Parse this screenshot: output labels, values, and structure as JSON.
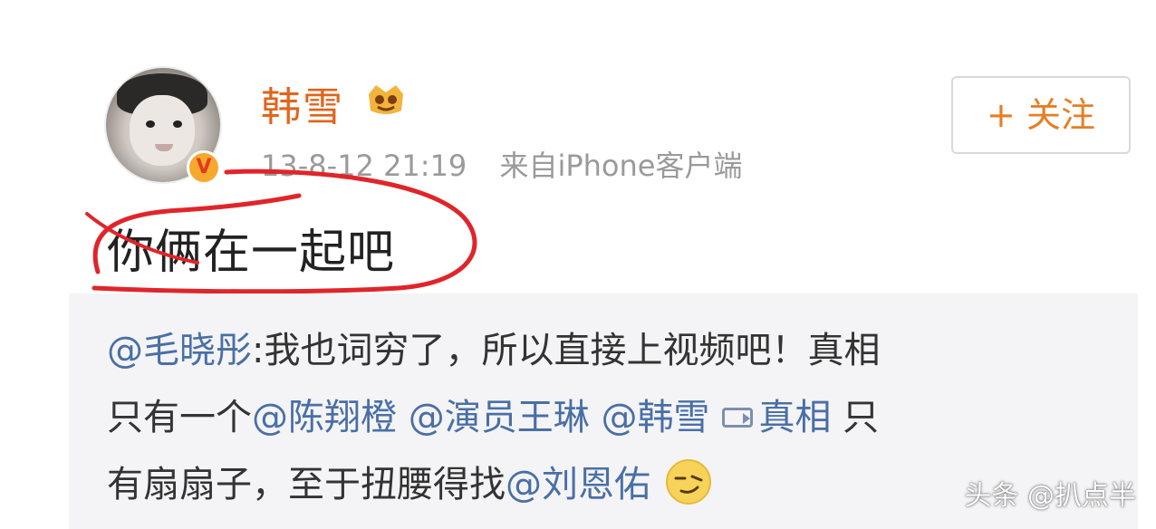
{
  "post": {
    "author": {
      "name": "韩雪",
      "verified_mark": "V",
      "avatar_icon": "baby-photo-avatar",
      "member_badge_icon": "vip-crown-icon"
    },
    "timestamp": "13-8-12 21:19",
    "source": "来自iPhone客户端",
    "follow_label": "+ 关注",
    "text": "你俩在一起吧"
  },
  "repost": {
    "line1": {
      "mention": "@毛晓彤",
      "text": ":我也词穷了，所以直接上视频吧！真相"
    },
    "line2": {
      "prefix": "只有一个",
      "mention1": "@陈翔橙",
      "mention2": "@演员王琳",
      "mention3": "@韩雪",
      "video_icon": "video-icon",
      "video_link": "真相",
      "suffix": "只"
    },
    "line3": {
      "text": "有扇扇子，至于扭腰得找",
      "mention": "@刘恩佑",
      "emoji_icon": "smirk-emoji-icon"
    }
  },
  "watermark": "头条 @扒点半",
  "colors": {
    "username": "#e0651c",
    "follow": "#e77e24",
    "link": "#4a6fa5",
    "annotation": "#e0252a",
    "repost_bg": "#f4f4f6"
  }
}
